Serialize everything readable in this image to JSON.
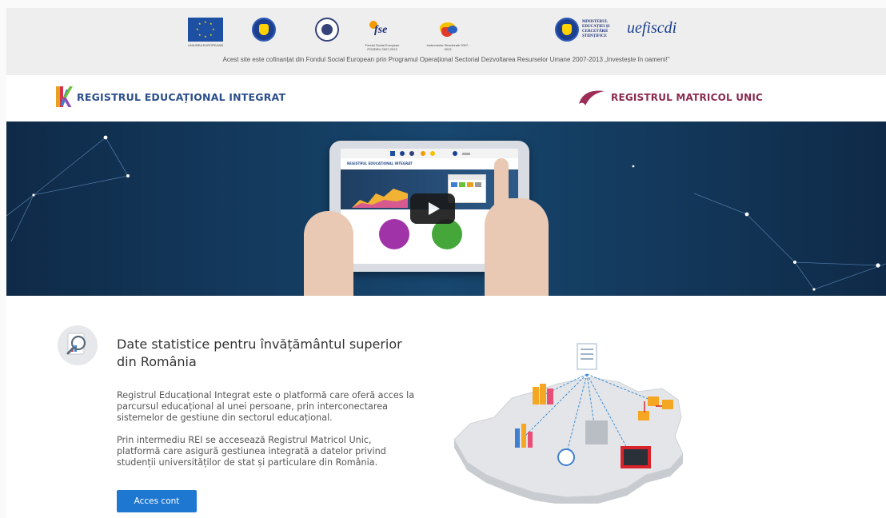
{
  "cofinance_notice": "Acest site este cofinanțat din Fondul Social European prin Programul Operațional Sectorial Dezvoltarea Resurselor Umane 2007-2013 „Investește în oameni!”",
  "logos": {
    "eu_caption": "UNIUNEA EUROPEANĂ",
    "fse_caption": "Fondul Social European POSDRU 2007-2013",
    "is_caption": "Instrumente Structurale 2007-2013",
    "ministry_text": "MINISTERUL EDUCAȚIEI ȘI CERCETĂRII ȘTIINȚIFICE",
    "uefiscdi_text": "uefiscdi"
  },
  "brand": {
    "rei_title": "REGISTRUL EDUCAȚIONAL INTEGRAT",
    "rmu_title": "REGISTRUL MATRICOL UNIC"
  },
  "hero": {
    "screen_brand": "REGISTRUL EDUCAȚIONAL INTEGRAT"
  },
  "content": {
    "heading": "Date statistice pentru învățământul superior din România",
    "paragraph1": "Registrul Educațional Integrat este o platformă care oferă acces la parcursul educațional al unei persoane, prin interconectarea sistemelor de gestiune din sectorul educațional.",
    "paragraph2": "Prin intermediu REI se accesează Registrul Matricol Unic, platformă care asigură gestiunea integrată a datelor privind studenții universităților de stat și particulare din România.",
    "access_button": "Acces cont"
  },
  "colors": {
    "accent_blue": "#1e77d0",
    "rei_blue": "#2c4f8c",
    "rmu_wine": "#8b2a4f",
    "hero_navy": "#17466e"
  }
}
